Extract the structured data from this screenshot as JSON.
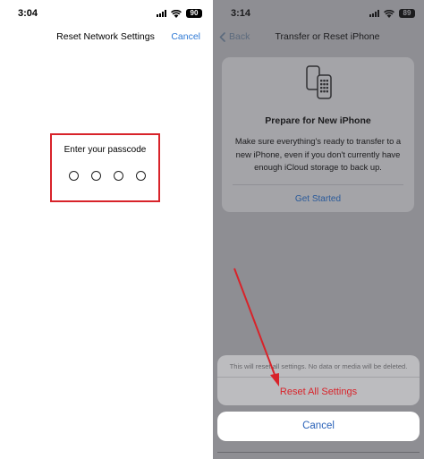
{
  "left_screen": {
    "status": {
      "time": "3:04",
      "battery": "90"
    },
    "nav": {
      "title": "Reset Network Settings",
      "cancel_label": "Cancel"
    },
    "passcode": {
      "prompt": "Enter your passcode",
      "digits_entered": 0,
      "digits_total": 4
    }
  },
  "right_screen": {
    "status": {
      "time": "3:14",
      "battery": "89"
    },
    "nav": {
      "back_label": "Back",
      "title": "Transfer or Reset iPhone"
    },
    "card": {
      "icon": "iphone-transfer-icon",
      "title": "Prepare for New iPhone",
      "body": "Make sure everything's ready to transfer to a new iPhone, even if you don't currently have enough iCloud storage to back up.",
      "link": "Get Started"
    },
    "action_sheet": {
      "message": "This will reset all settings. No data or media will be deleted.",
      "action_label": "Reset All Settings",
      "cancel_label": "Cancel"
    }
  },
  "colors": {
    "highlight": "#d8232a",
    "link_blue": "#2e79d5",
    "dim_overlay": "#8e8e93",
    "destructive": "#d8232a"
  }
}
